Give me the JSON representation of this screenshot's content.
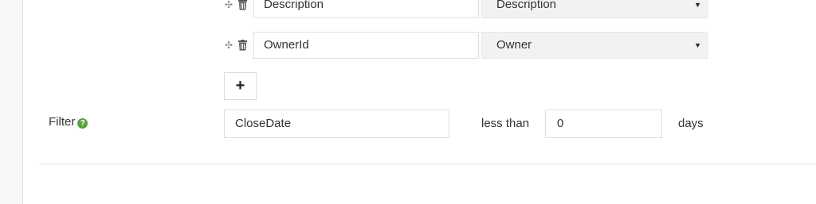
{
  "fields": [
    {
      "name": "Description",
      "mapping": "Description"
    },
    {
      "name": "OwnerId",
      "mapping": "Owner"
    }
  ],
  "add_button": {
    "label": "+"
  },
  "filter": {
    "label": "Filter",
    "help_icon": "?",
    "field": "CloseDate",
    "operator": "less than",
    "value": "0",
    "unit": "days"
  },
  "icons": {
    "drag": "move-icon",
    "delete": "trash-icon",
    "help": "question-circle-icon",
    "dropdown": "caret-down-icon"
  },
  "colors": {
    "help_icon": "#5aa33b",
    "select_background": "#f2f2f2"
  }
}
